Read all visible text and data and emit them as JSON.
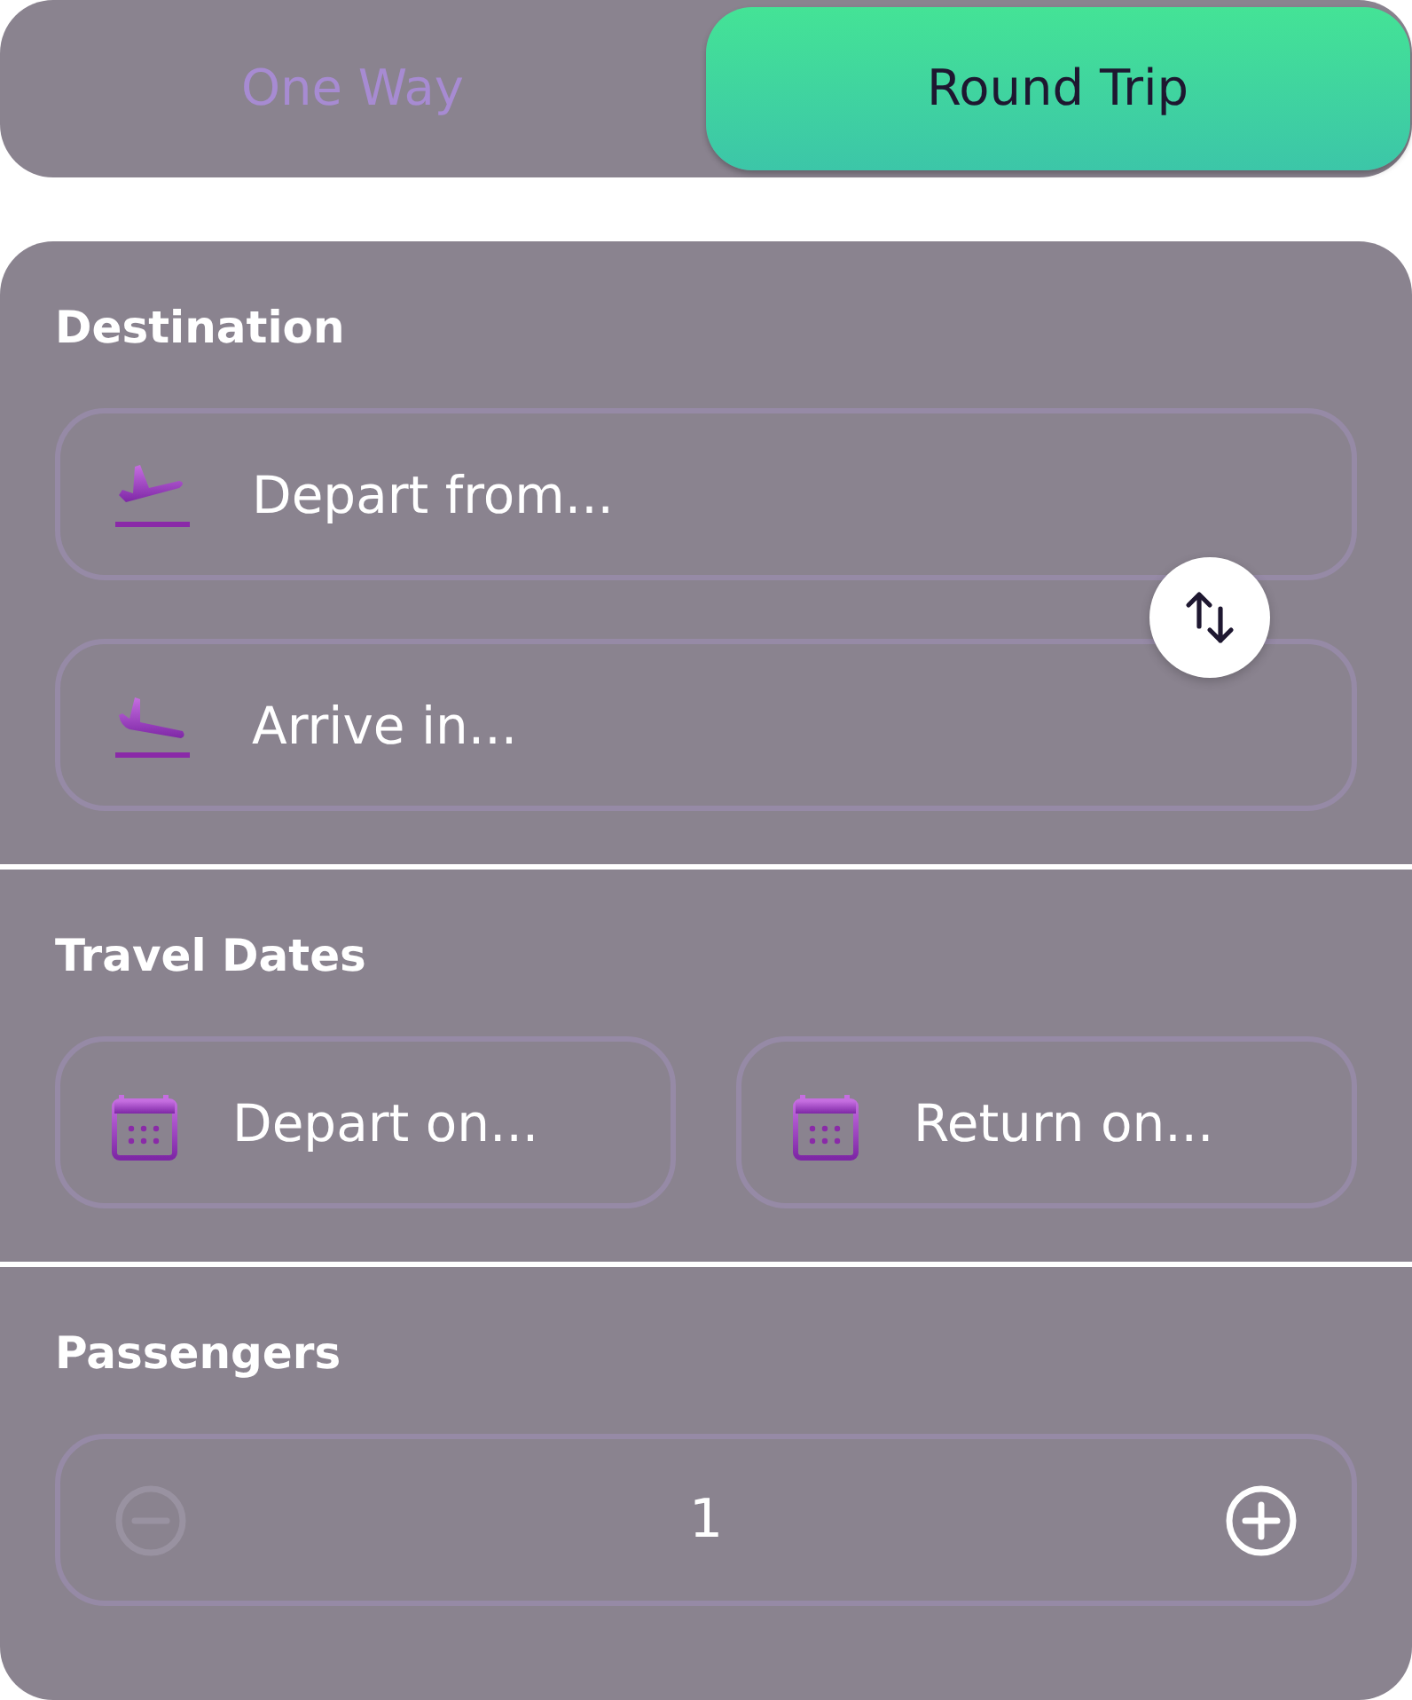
{
  "trip_tabs": [
    {
      "label": "One Way",
      "selected": false
    },
    {
      "label": "Round Trip",
      "selected": true
    }
  ],
  "destination": {
    "heading": "Destination",
    "from": {
      "placeholder": "Depart from..."
    },
    "to": {
      "placeholder": "Arrive in..."
    }
  },
  "travel_dates": {
    "heading": "Travel Dates",
    "depart": {
      "placeholder": "Depart on..."
    },
    "return": {
      "placeholder": "Return on..."
    }
  },
  "passengers": {
    "heading": "Passengers",
    "count": "1",
    "decrement": {
      "disabled": true
    },
    "increment": {
      "disabled": false
    }
  }
}
